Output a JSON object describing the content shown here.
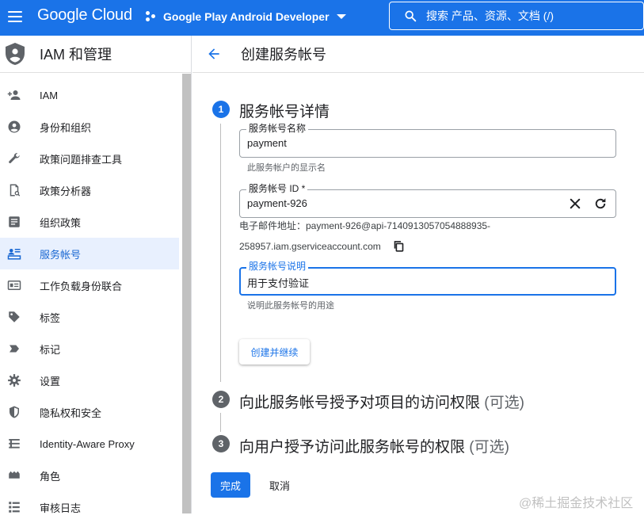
{
  "header": {
    "logo": "Google Cloud",
    "project": "Google Play Android Developer",
    "search_placeholder": "搜索  产品、资源、文档 (/)"
  },
  "sidebar": {
    "title": "IAM 和管理",
    "items": [
      {
        "label": "IAM",
        "icon": "person-add-icon"
      },
      {
        "label": "身份和组织",
        "icon": "account-circle-icon"
      },
      {
        "label": "政策问题排查工具",
        "icon": "wrench-icon"
      },
      {
        "label": "政策分析器",
        "icon": "policy-analyzer-icon"
      },
      {
        "label": "组织政策",
        "icon": "list-article-icon"
      },
      {
        "label": "服务帐号",
        "icon": "service-account-icon",
        "active": true
      },
      {
        "label": "工作负载身份联合",
        "icon": "id-card-icon"
      },
      {
        "label": "标签",
        "icon": "tag-icon"
      },
      {
        "label": "标记",
        "icon": "label-icon"
      },
      {
        "label": "设置",
        "icon": "gear-icon"
      },
      {
        "label": "隐私权和安全",
        "icon": "shield-icon"
      },
      {
        "label": "Identity-Aware Proxy",
        "icon": "proxy-icon"
      },
      {
        "label": "角色",
        "icon": "roles-icon"
      },
      {
        "label": "审核日志",
        "icon": "audit-log-icon"
      }
    ]
  },
  "page": {
    "title": "创建服务帐号"
  },
  "steps": [
    {
      "number": "1",
      "title": "服务帐号详情",
      "optional": ""
    },
    {
      "number": "2",
      "title": "向此服务帐号授予对项目的访问权限",
      "optional": "(可选)"
    },
    {
      "number": "3",
      "title": "向用户授予访问此服务帐号的权限",
      "optional": "(可选)"
    }
  ],
  "form": {
    "name": {
      "label": "服务帐号名称",
      "value": "payment",
      "helper": "此服务帐户的显示名"
    },
    "id": {
      "label": "服务帐号 ID *",
      "value": "payment-926"
    },
    "email_line1": "电子邮件地址：payment-926@api-7140913057054888935-",
    "email_line2": "258957.iam.gserviceaccount.com",
    "description": {
      "label": "服务帐号说明",
      "value": "用于支付验证",
      "helper": "说明此服务帐号的用途"
    },
    "create_button": "创建并继续"
  },
  "actions": {
    "done": "完成",
    "cancel": "取消"
  },
  "watermark": "@稀土掘金技术社区",
  "colors": {
    "primary": "#1a73e8",
    "step_inactive": "#5f6368",
    "active_bg": "#e8f0fe"
  }
}
